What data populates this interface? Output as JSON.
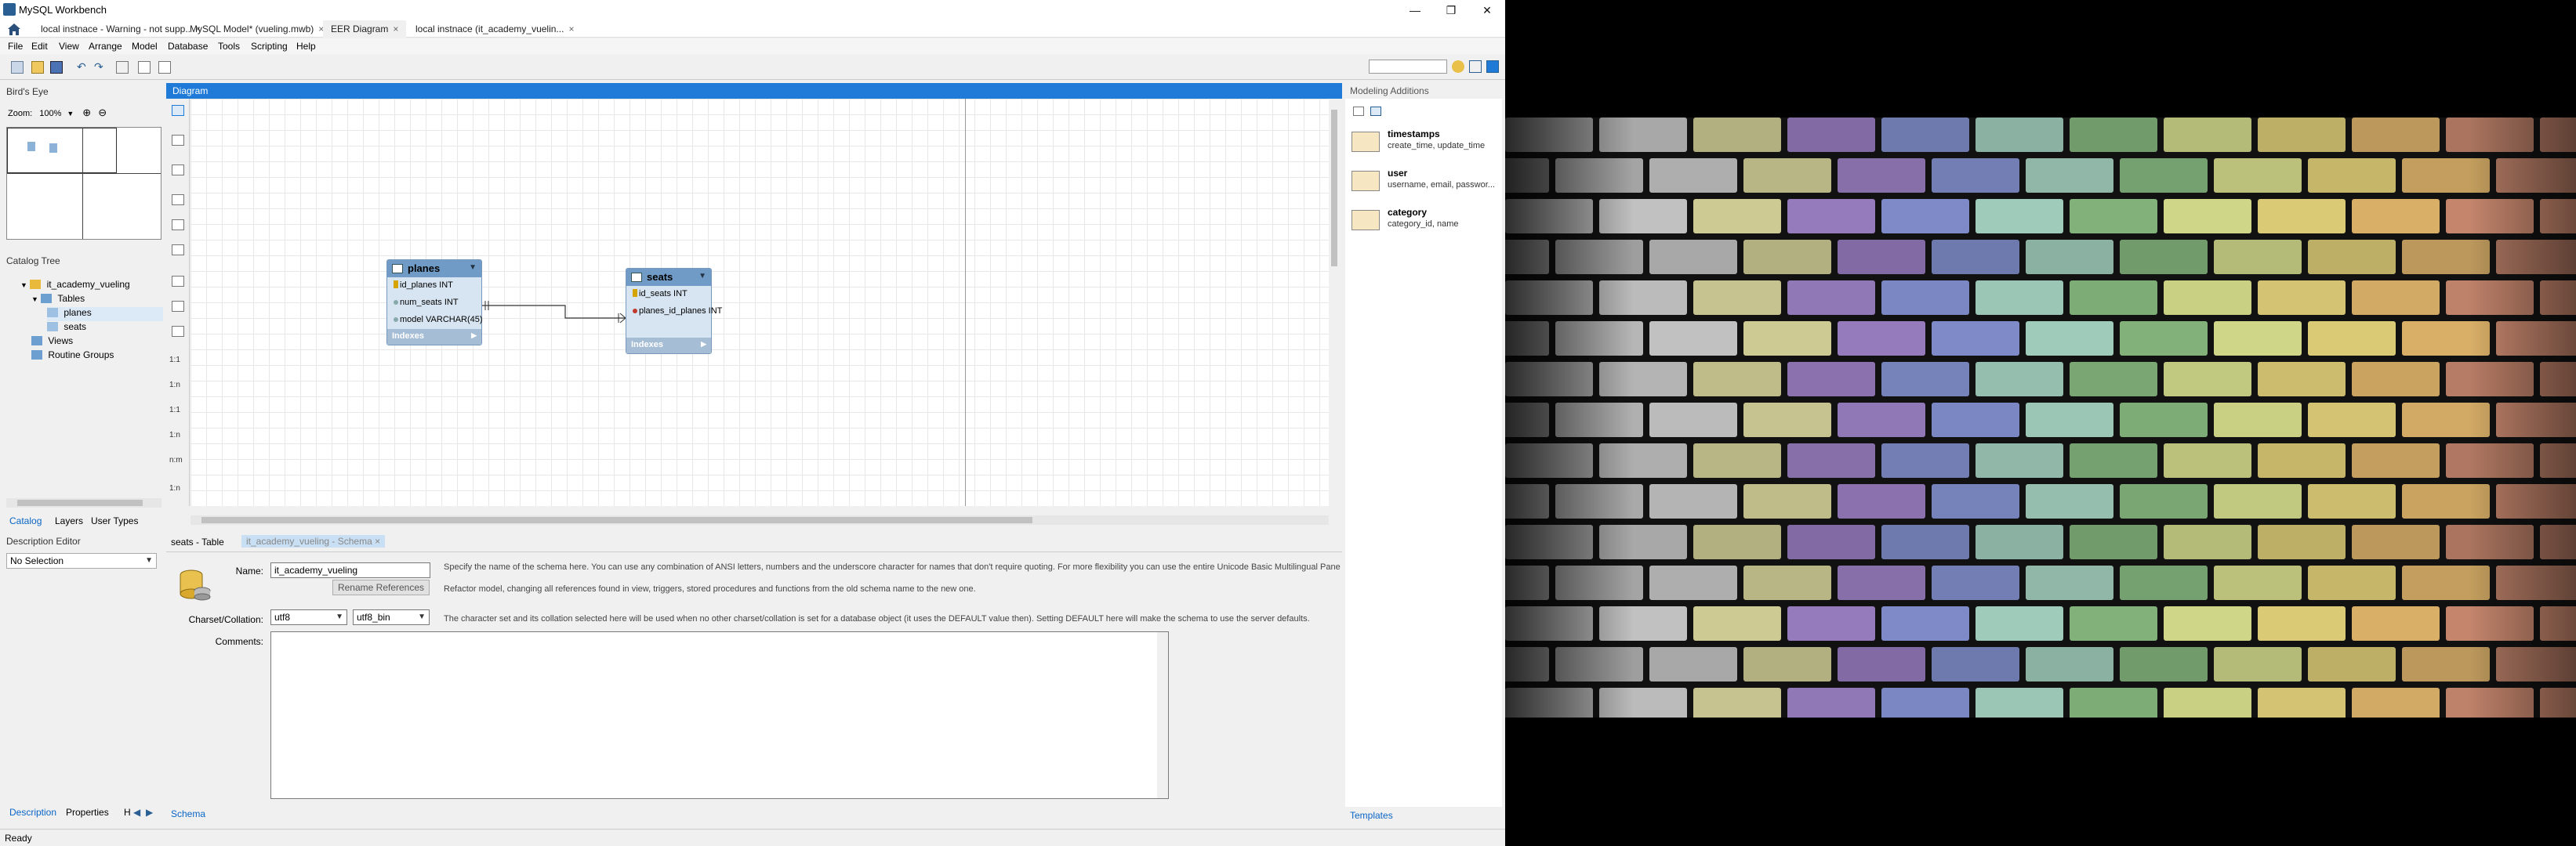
{
  "window": {
    "title": "MySQL Workbench",
    "controls": [
      "minimize-icon",
      "restore-icon",
      "close-icon"
    ]
  },
  "doc_tabs": [
    {
      "label": "local instnace - Warning - not supp..",
      "closable": true
    },
    {
      "label": "MySQL Model* (vueling.mwb)",
      "closable": true
    },
    {
      "label": "EER Diagram",
      "closable": true
    },
    {
      "label": "local instnace (it_academy_vuelin...",
      "closable": true
    }
  ],
  "menu": [
    "File",
    "Edit",
    "View",
    "Arrange",
    "Model",
    "Database",
    "Tools",
    "Scripting",
    "Help"
  ],
  "birds_eye": {
    "title": "Bird's Eye",
    "zoom_label": "Zoom:",
    "zoom_value": "100%"
  },
  "catalog": {
    "title": "Catalog Tree",
    "schema": "it_academy_vueling",
    "tables_label": "Tables",
    "tables": [
      "planes",
      "seats"
    ],
    "views_label": "Views",
    "routines_label": "Routine Groups"
  },
  "left_tabs": [
    "Catalog",
    "Layers",
    "User Types"
  ],
  "description_editor": {
    "title": "Description Editor",
    "selection": "No Selection"
  },
  "left_bottom_tabs": [
    "Description",
    "Properties",
    "H"
  ],
  "diagram": {
    "title": "Diagram",
    "tables": [
      {
        "name": "planes",
        "columns": [
          {
            "kind": "pk",
            "text": "id_planes INT"
          },
          {
            "kind": "col",
            "text": "num_seats INT"
          },
          {
            "kind": "col",
            "text": "model VARCHAR(45)"
          }
        ],
        "indexes_label": "Indexes"
      },
      {
        "name": "seats",
        "columns": [
          {
            "kind": "pk",
            "text": "id_seats INT"
          },
          {
            "kind": "fk",
            "text": "planes_id_planes INT"
          }
        ],
        "indexes_label": "Indexes"
      }
    ],
    "palette_labels": [
      "1:1",
      "1:n",
      "1:1",
      "1:n",
      "n:m",
      "1:n"
    ]
  },
  "editor": {
    "tabs": [
      "seats - Table",
      "it_academy_vueling - Schema"
    ],
    "name_label": "Name:",
    "name_value": "it_academy_vueling",
    "name_help": "Specify the name of the schema here. You can use any combination of ANSI letters, numbers and the underscore character for names that don't require quoting. For more flexibility you can use the entire Unicode Basic Multilingual Pane",
    "rename_button": "Rename References",
    "rename_help": "Refactor model, changing all references found in view, triggers, stored procedures and functions from the old schema name to the new one.",
    "charset_label": "Charset/Collation:",
    "charset_value": "utf8",
    "collation_value": "utf8_bin",
    "charset_help": "The character set and its collation selected here will be used when no other charset/collation is set for a database object (it uses the DEFAULT value then). Setting DEFAULT here will make the schema to use the server defaults.",
    "comments_label": "Comments:",
    "bottom_tab": "Schema"
  },
  "modeling_additions": {
    "title": "Modeling Additions",
    "items": [
      {
        "name": "timestamps",
        "desc": "create_time, update_time"
      },
      {
        "name": "user",
        "desc": "username, email, passwor..."
      },
      {
        "name": "category",
        "desc": "category_id, name"
      }
    ],
    "templates_tab": "Templates"
  },
  "status": "Ready",
  "wallpaper": {
    "subject": "painted-brick-wall",
    "band_colors": [
      "#bdbdbd",
      "#c9c9c9",
      "#d6d29a",
      "#9b7fc4",
      "#8391d0",
      "#a6d4c2",
      "#87b97f",
      "#d8df8d",
      "#e4d27a",
      "#e2b66c",
      "#cc8a70"
    ]
  }
}
